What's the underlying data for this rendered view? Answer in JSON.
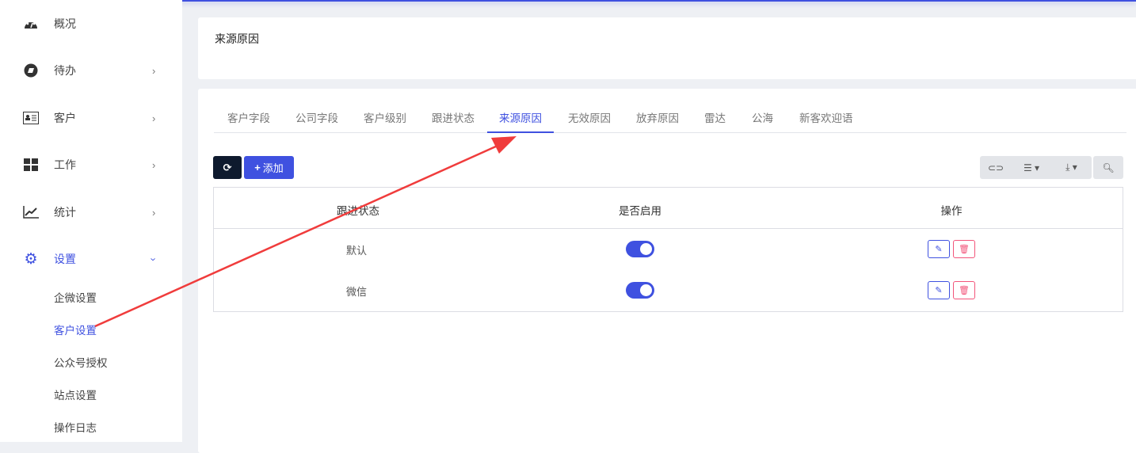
{
  "sidebar": {
    "items": [
      {
        "label": "概况",
        "icon": "dashboard-icon"
      },
      {
        "label": "待办",
        "icon": "compass-icon"
      },
      {
        "label": "客户",
        "icon": "id-card-icon"
      },
      {
        "label": "工作",
        "icon": "grid-icon"
      },
      {
        "label": "统计",
        "icon": "line-chart-icon"
      },
      {
        "label": "设置",
        "icon": "gear-icon"
      }
    ],
    "sub_items": [
      "企微设置",
      "客户设置",
      "公众号授权",
      "站点设置",
      "操作日志"
    ]
  },
  "header": {
    "title": "来源原因"
  },
  "tabs": [
    "客户字段",
    "公司字段",
    "客户级别",
    "跟进状态",
    "来源原因",
    "无效原因",
    "放弃原因",
    "雷达",
    "公海",
    "新客欢迎语"
  ],
  "toolbar": {
    "add_label": "添加"
  },
  "table": {
    "columns": [
      "跟进状态",
      "是否启用",
      "操作"
    ],
    "rows": [
      {
        "name": "默认",
        "enabled": true
      },
      {
        "name": "微信",
        "enabled": true
      }
    ]
  },
  "colors": {
    "accent": "#3f51e0",
    "danger": "#f2557a",
    "annotation": "#f03c3c"
  }
}
